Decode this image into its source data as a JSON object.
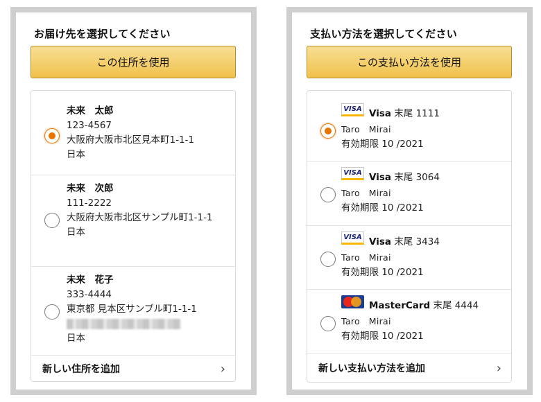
{
  "address_panel": {
    "title": "お届け先を選択してください",
    "use_button": "この住所を使用",
    "addresses": [
      {
        "name": "未来　太郎",
        "postal": "123-4567",
        "address": "大阪府大阪市北区見本町1-1-1",
        "country": "日本",
        "selected": true
      },
      {
        "name": "未来　次郎",
        "postal": "111-2222",
        "address": "大阪府大阪市北区サンプル町1-1-1",
        "country": "日本",
        "selected": false
      },
      {
        "name": "未来　花子",
        "postal": "333-4444",
        "address": "東京都 見本区サンプル町1-1-1",
        "country": "日本",
        "selected": false
      }
    ],
    "add_label": "新しい住所を追加",
    "add_chevron": "›"
  },
  "payment_panel": {
    "title": "支払い方法を選択してください",
    "use_button": "この支払い方法を使用",
    "methods": [
      {
        "brand": "Visa",
        "icon": "visa-card-icon",
        "icon_text": "VISA",
        "suffix": "末尾 1111",
        "holder": "Taro　Mirai",
        "expiry": "有効期限 10 /2021",
        "selected": true
      },
      {
        "brand": "Visa",
        "icon": "visa-card-icon",
        "icon_text": "VISA",
        "suffix": "末尾 3064",
        "holder": "Taro　Mirai",
        "expiry": "有効期限 10 /2021",
        "selected": false
      },
      {
        "brand": "Visa",
        "icon": "visa-card-icon",
        "icon_text": "VISA",
        "suffix": "末尾 3434",
        "holder": "Taro　Mirai",
        "expiry": "有効期限 10 /2021",
        "selected": false
      },
      {
        "brand": "MasterCard",
        "icon": "mastercard-icon",
        "icon_text": "MasterCard",
        "suffix": "末尾 4444",
        "holder": "Taro　Mirai",
        "expiry": "有効期限 10 /2021",
        "selected": false
      }
    ],
    "add_label": "新しい支払い方法を追加",
    "add_chevron": "›"
  },
  "colors": {
    "radio_selected": "#e77600",
    "button_top": "#f8df95",
    "button_bottom": "#f0c14b",
    "panel_border": "#cfcfcf"
  }
}
